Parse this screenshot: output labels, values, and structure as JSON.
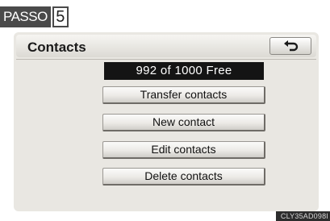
{
  "step": {
    "word": "PASSO",
    "number": "5"
  },
  "screen": {
    "title": "Contacts",
    "back_icon": "return-arrow-icon",
    "capacity_text": "992 of 1000 Free",
    "buttons": [
      {
        "label": "Transfer contacts"
      },
      {
        "label": "New contact"
      },
      {
        "label": "Edit contacts"
      },
      {
        "label": "Delete contacts"
      }
    ]
  },
  "image_code": "CLY35AD098I",
  "colors": {
    "screen_bg": "#e9e7e2",
    "count_bg": "#141414",
    "badge_bg": "#4a4a4a"
  }
}
